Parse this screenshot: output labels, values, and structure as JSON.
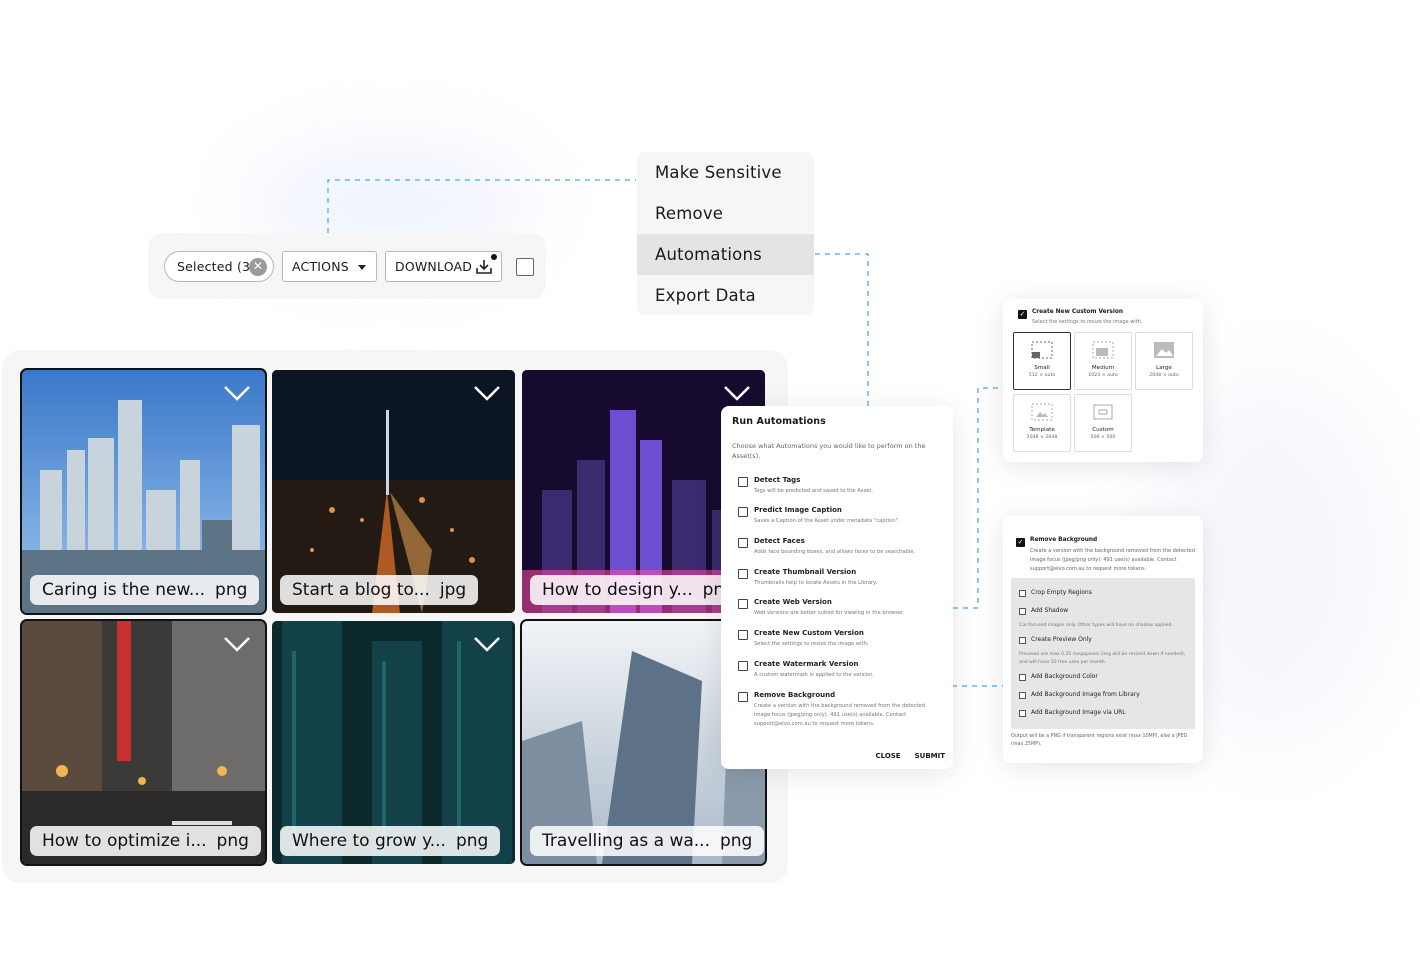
{
  "toolbar": {
    "selected_label": "Selected (3)",
    "actions_label": "ACTIONS",
    "download_label": "DOWNLOAD"
  },
  "menu": {
    "items": [
      {
        "label": "Make Sensitive"
      },
      {
        "label": "Remove"
      },
      {
        "label": "Automations",
        "active": true
      },
      {
        "label": "Export Data"
      }
    ]
  },
  "assets": [
    {
      "name": "Caring is the new...",
      "ext": "png",
      "selected": true
    },
    {
      "name": "Start a blog to...",
      "ext": "jpg",
      "selected": false
    },
    {
      "name": "How to design y...",
      "ext": "png",
      "selected": false
    },
    {
      "name": "How to optimize i...",
      "ext": "png",
      "selected": true
    },
    {
      "name": "Where to grow y...",
      "ext": "png",
      "selected": false
    },
    {
      "name": "Travelling as a wa...",
      "ext": "png",
      "selected": true
    }
  ],
  "run_automations": {
    "title": "Run Automations",
    "subtitle": "Choose what Automations you would like to perform on the Asset(s).",
    "options": [
      {
        "title": "Detect Tags",
        "desc": "Tags will be predicted and saved to the Asset."
      },
      {
        "title": "Predict Image Caption",
        "desc": "Saves a Caption of the Asset under metadata \"caption\"."
      },
      {
        "title": "Detect Faces",
        "desc": "Adds face bounding boxes, and allows faces to be searchable."
      },
      {
        "title": "Create Thumbnail Version",
        "desc": "Thumbnails help to locate Assets in the Library."
      },
      {
        "title": "Create Web Version",
        "desc": "Web versions are better suited for viewing in the browser."
      },
      {
        "title": "Create New Custom Version",
        "desc": "Select the settings to resize the image with."
      },
      {
        "title": "Create Watermark Version",
        "desc": "A custom watermark is applied to the version."
      },
      {
        "title": "Remove Background",
        "desc": "Create a version with the background removed from the detected image focus (jpeg/png only). 491 use(s) available. Contact support@elvo.com.au to request more tokens."
      }
    ],
    "close_label": "CLOSE",
    "submit_label": "SUBMIT"
  },
  "custom_version": {
    "title": "Create New Custom Version",
    "subtitle": "Select the settings to resize the image with.",
    "sizes": [
      {
        "name": "Small",
        "dims": "512 × auto",
        "selected": true
      },
      {
        "name": "Medium",
        "dims": "1024 × auto",
        "selected": false
      },
      {
        "name": "Large",
        "dims": "2048 × auto",
        "selected": false
      },
      {
        "name": "Template",
        "dims": "2048 × 2048",
        "selected": false
      },
      {
        "name": "Custom",
        "dims": "500 × 500",
        "selected": false
      }
    ]
  },
  "remove_background": {
    "title": "Remove Background",
    "desc": "Create a version with the background removed from the detected image focus (jpeg/png only). 491 use(s) available. Contact support@elvo.com.au to request more tokens.",
    "options": [
      {
        "label": "Crop Empty Regions"
      },
      {
        "label": "Add Shadow"
      },
      {
        "label": "Create Preview Only"
      },
      {
        "label": "Add Background Color"
      },
      {
        "label": "Add Background Image from Library"
      },
      {
        "label": "Add Background Image via URL"
      }
    ],
    "shadow_note": "Car-focused images only. Other types will have no shadow applied.",
    "preview_note": "Previews are max 0.25 megapixels (img will be resized down if needed), and will have 50 free uses per month.",
    "footer": "Output will be a PNG if transparent regions exist (max 10MP), else a JPEG (max 25MP)."
  },
  "colors": {
    "connector": "#6cb4ee",
    "panel_bg": "#f6f6f7",
    "active_menu": "#e4e4e6"
  }
}
